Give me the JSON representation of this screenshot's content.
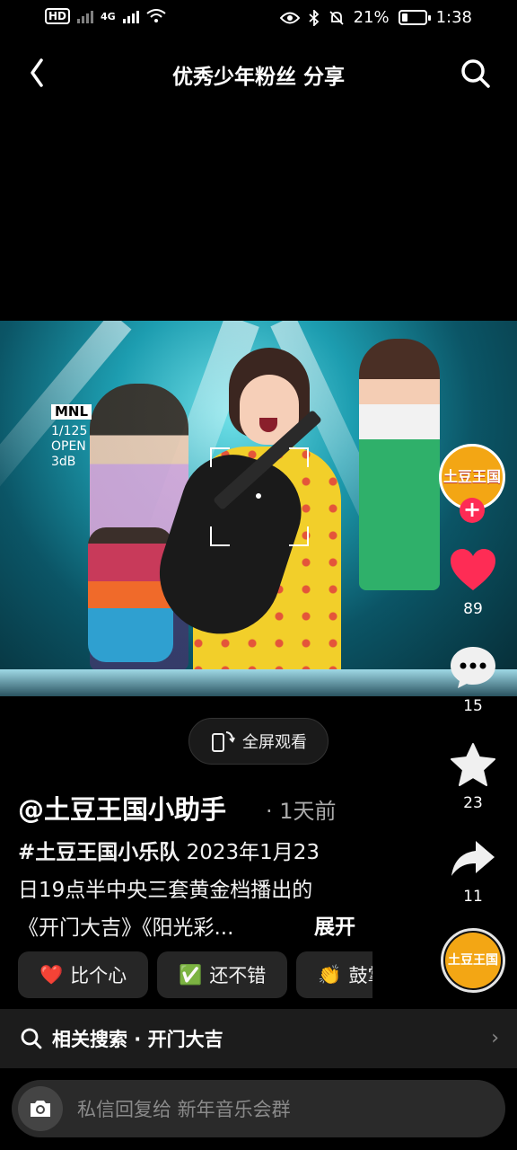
{
  "status_bar": {
    "battery": "21%",
    "time": "1:38",
    "network": "4G"
  },
  "header": {
    "title": "优秀少年粉丝 分享"
  },
  "video": {
    "overlay": {
      "badge": "MNL",
      "line1": "1/125",
      "line2": "OPEN",
      "line3": "3dB"
    }
  },
  "rail": {
    "avatar_text": "土豆王国",
    "likes": "89",
    "comments": "15",
    "favorites": "23",
    "shares": "11"
  },
  "fullscreen": {
    "label": "全屏观看"
  },
  "post": {
    "author": "@土豆王国小助手",
    "time": "· 1天前",
    "hashtag": "#土豆王国小乐队",
    "desc_line1_rest": " 2023年1月23",
    "desc_line2": "日19点半中央三套黄金档播出的",
    "desc_line3": "《开门大吉》《阳光彩...",
    "expand": "展开"
  },
  "chips": [
    {
      "emoji": "❤️",
      "label": "比个心"
    },
    {
      "emoji": "✅",
      "label": "还不错"
    },
    {
      "emoji": "👏",
      "label": "鼓掌"
    }
  ],
  "related": {
    "label": "相关搜索 · 开门大吉"
  },
  "reply": {
    "placeholder": "私信回复给 新年音乐会群"
  },
  "colors": {
    "like": "#fe2c55",
    "avatar": "#f3a614",
    "background": "#000000"
  }
}
